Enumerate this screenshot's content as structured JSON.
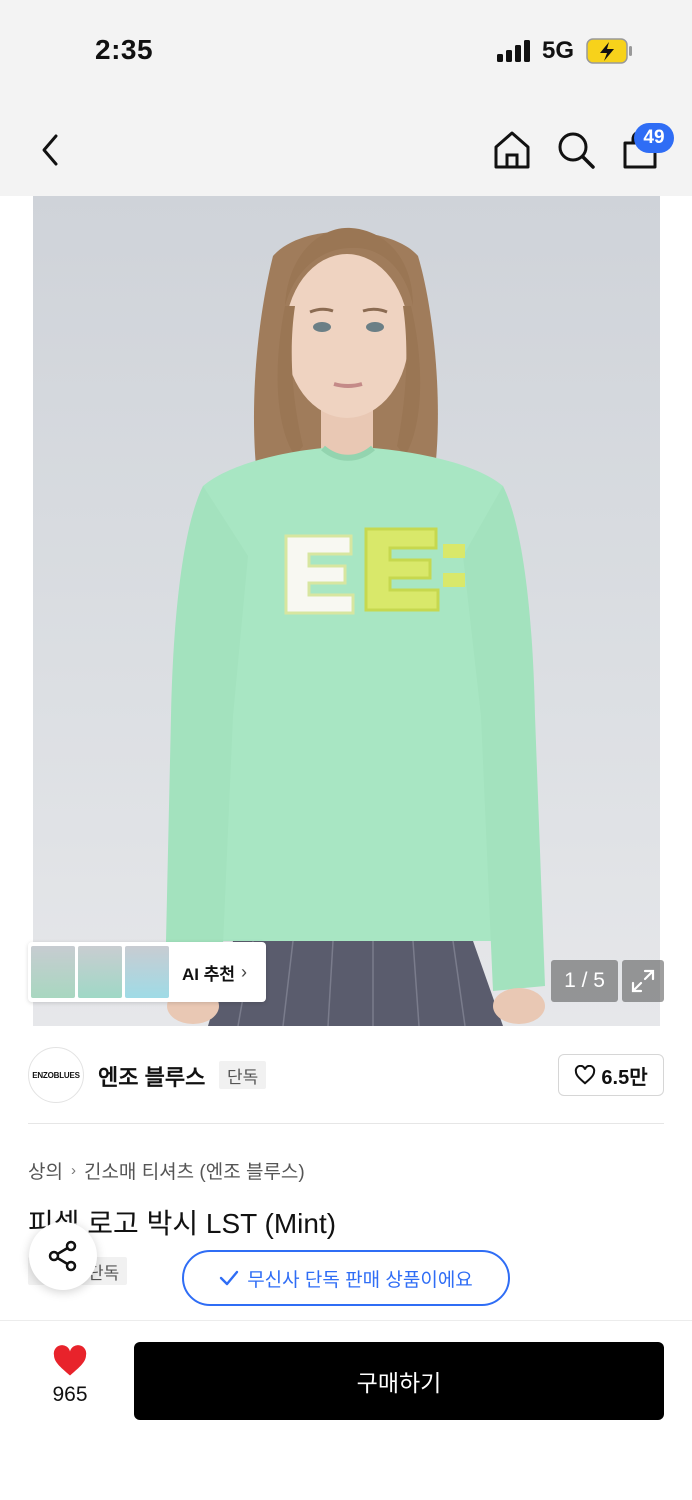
{
  "status": {
    "time": "2:35",
    "network": "5G"
  },
  "nav": {
    "cart_count": "49"
  },
  "gallery": {
    "ai_recommend": "AI 추천",
    "page_counter": "1 / 5"
  },
  "brand": {
    "logo_text": "ENZOBLUES",
    "name": "엔조 블루스",
    "tag": "단독",
    "likes": "6.5만"
  },
  "breadcrumb": [
    "상의",
    "긴소매 티셔츠 (엔조 블루스)"
  ],
  "product": {
    "title": "피셀 로고 박시 LST (Mint)",
    "tag": "단독"
  },
  "toast": {
    "message": "무신사 단독 판매 상품이에요"
  },
  "bottom": {
    "wish_count": "965",
    "buy_label": "구매하기"
  },
  "colors": {
    "accent": "#2f6df5",
    "heart": "#e8232b",
    "buy_button": "#000000",
    "shirt": "#a8e6c3"
  }
}
